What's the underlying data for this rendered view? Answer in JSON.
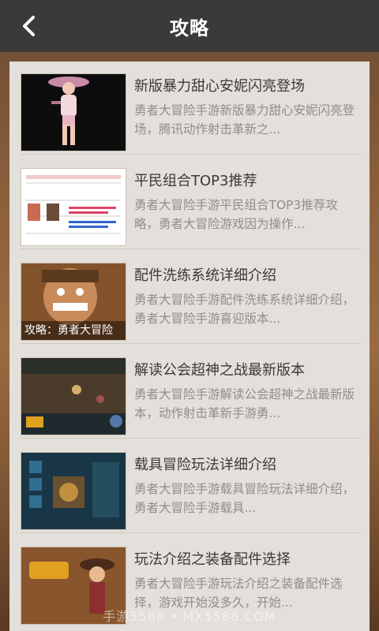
{
  "header": {
    "title": "攻略",
    "back_icon": "back-arrow-icon"
  },
  "articles": [
    {
      "title": "新版暴力甜心安妮闪亮登场",
      "desc": "勇者大冒险手游新版暴力甜心安妮闪亮登场，腾讯动作射击革新之..."
    },
    {
      "title": "平民组合TOP3推荐",
      "desc": "勇者大冒险手游平民组合TOP3推荐攻略，勇者大冒险游戏因为操作..."
    },
    {
      "title": "配件洗练系统详细介绍",
      "desc": "勇者大冒险手游配件洗练系统详细介绍，勇者大冒险手游喜迎版本...",
      "thumb_caption": "攻略：勇者大冒险"
    },
    {
      "title": "解读公会超神之战最新版本",
      "desc": "勇者大冒险手游解读公会超神之战最新版本，动作射击革新手游勇..."
    },
    {
      "title": "载具冒险玩法详细介绍",
      "desc": "勇者大冒险手游载具冒险玩法详细介绍，勇者大冒险手游载具..."
    },
    {
      "title": "玩法介绍之装备配件选择",
      "desc": "勇者大冒险手游玩法介绍之装备配件选择，游戏开始没多久，开始..."
    }
  ],
  "watermark": "手游5588 • MX5588.COM"
}
